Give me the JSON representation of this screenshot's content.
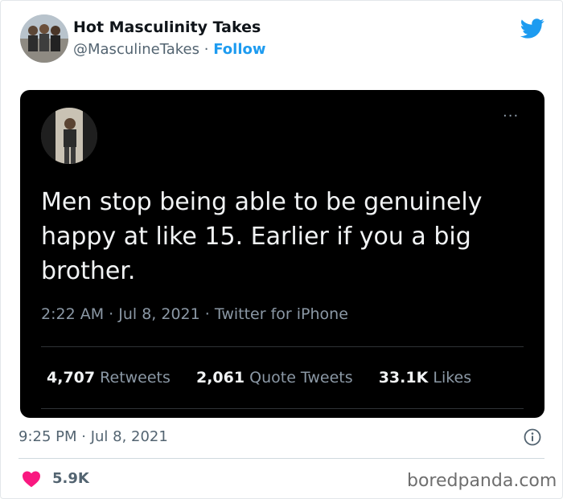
{
  "author": {
    "name": "Hot Masculinity Takes",
    "handle": "@MasculineTakes",
    "separator": "·",
    "follow_label": "Follow"
  },
  "screenshot": {
    "text": "Men stop being able to be genuinely happy at like 15. Earlier if you a big brother.",
    "time": "2:22 AM",
    "date": "Jul 8, 2021",
    "source": "Twitter for iPhone",
    "stats": [
      {
        "count": "4,707",
        "label": "Retweets"
      },
      {
        "count": "2,061",
        "label": "Quote Tweets"
      },
      {
        "count": "33.1K",
        "label": "Likes"
      }
    ]
  },
  "footer": {
    "timestamp": "9:25 PM · Jul 8, 2021",
    "likes": "5.9K"
  },
  "watermark": "boredpanda.com",
  "colors": {
    "twitter_blue": "#1d9bf0",
    "heart_red": "#f91880",
    "screenshot_bg": "#000000"
  },
  "icons": [
    "twitter-bird-icon",
    "more-icon",
    "info-icon",
    "heart-icon"
  ]
}
